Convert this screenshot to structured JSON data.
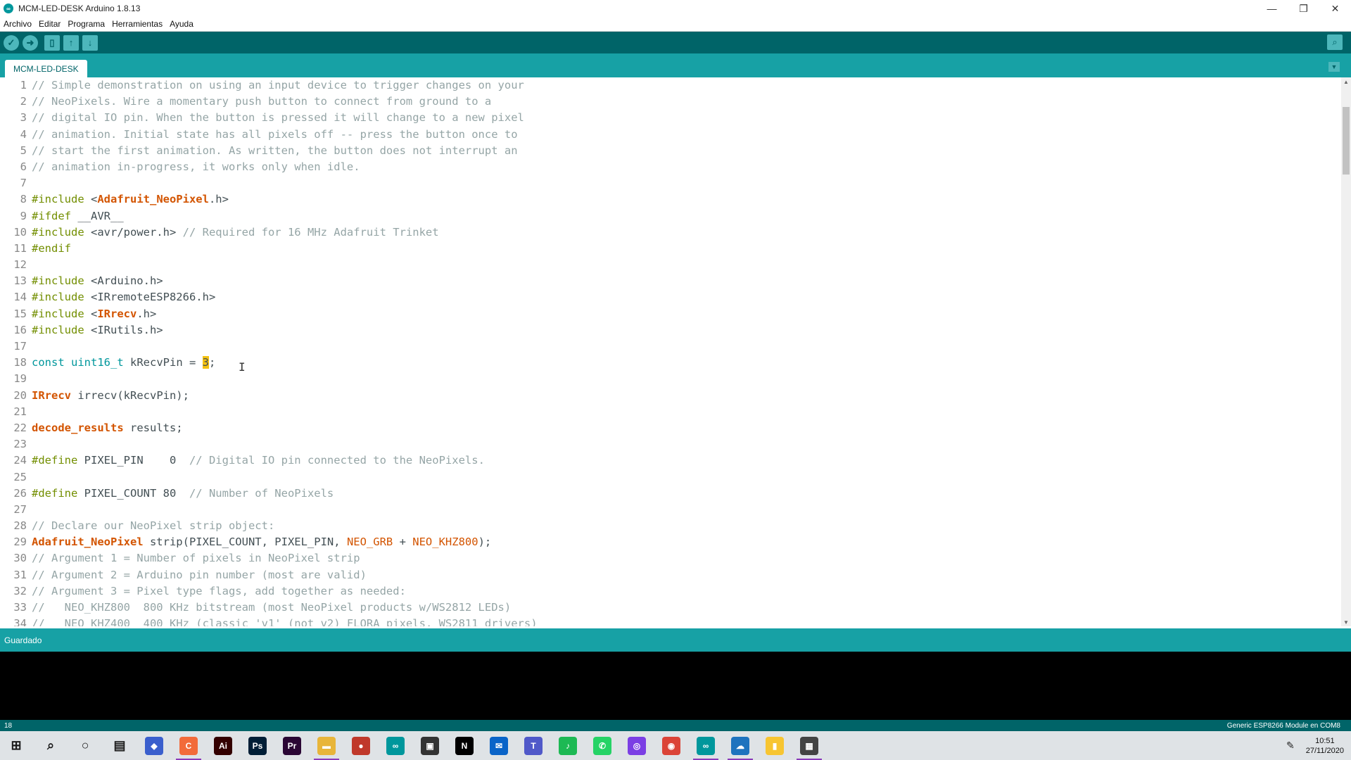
{
  "window": {
    "title": "MCM-LED-DESK Arduino 1.8.13",
    "controls": [
      "—",
      "❐",
      "✕"
    ]
  },
  "menubar": {
    "items": [
      "Archivo",
      "Editar",
      "Programa",
      "Herramientas",
      "Ayuda"
    ]
  },
  "toolbar": {
    "verify_icon": "check-icon",
    "upload_icon": "arrow-right-icon",
    "new_icon": "new-file-icon",
    "open_icon": "open-up-icon",
    "save_icon": "save-down-icon",
    "serial_icon": "magnifier-icon"
  },
  "tabs": {
    "active": "MCM-LED-DESK",
    "menu_icon": "chevron-down-icon"
  },
  "editor": {
    "cursor_line": 18,
    "lines": [
      {
        "n": "1",
        "parts": [
          {
            "c": "comment",
            "t": "// Simple demonstration on using an input device to trigger changes on your"
          }
        ]
      },
      {
        "n": "2",
        "parts": [
          {
            "c": "comment",
            "t": "// NeoPixels. Wire a momentary push button to connect from ground to a"
          }
        ]
      },
      {
        "n": "3",
        "parts": [
          {
            "c": "comment",
            "t": "// digital IO pin. When the button is pressed it will change to a new pixel"
          }
        ]
      },
      {
        "n": "4",
        "parts": [
          {
            "c": "comment",
            "t": "// animation. Initial state has all pixels off -- press the button once to"
          }
        ]
      },
      {
        "n": "5",
        "parts": [
          {
            "c": "comment",
            "t": "// start the first animation. As written, the button does not interrupt an"
          }
        ]
      },
      {
        "n": "6",
        "parts": [
          {
            "c": "comment",
            "t": "// animation in-progress, it works only when idle."
          }
        ]
      },
      {
        "n": "7",
        "parts": []
      },
      {
        "n": "8",
        "parts": [
          {
            "c": "directive",
            "t": "#include"
          },
          {
            "c": "plain",
            "t": " <"
          },
          {
            "c": "type",
            "t": "Adafruit_NeoPixel"
          },
          {
            "c": "plain",
            "t": ".h>"
          }
        ]
      },
      {
        "n": "9",
        "parts": [
          {
            "c": "directive",
            "t": "#ifdef"
          },
          {
            "c": "plain",
            "t": " __AVR__"
          }
        ]
      },
      {
        "n": "10",
        "parts": [
          {
            "c": "directive",
            "t": "#include"
          },
          {
            "c": "plain",
            "t": " <avr/power.h> "
          },
          {
            "c": "comment",
            "t": "// Required for 16 MHz Adafruit Trinket"
          }
        ]
      },
      {
        "n": "11",
        "parts": [
          {
            "c": "directive",
            "t": "#endif"
          }
        ]
      },
      {
        "n": "12",
        "parts": []
      },
      {
        "n": "13",
        "parts": [
          {
            "c": "directive",
            "t": "#include"
          },
          {
            "c": "plain",
            "t": " <Arduino.h>"
          }
        ]
      },
      {
        "n": "14",
        "parts": [
          {
            "c": "directive",
            "t": "#include"
          },
          {
            "c": "plain",
            "t": " <IRremoteESP8266.h>"
          }
        ]
      },
      {
        "n": "15",
        "parts": [
          {
            "c": "directive",
            "t": "#include"
          },
          {
            "c": "plain",
            "t": " <"
          },
          {
            "c": "type",
            "t": "IRrecv"
          },
          {
            "c": "plain",
            "t": ".h>"
          }
        ]
      },
      {
        "n": "16",
        "parts": [
          {
            "c": "directive",
            "t": "#include"
          },
          {
            "c": "plain",
            "t": " <IRutils.h>"
          }
        ]
      },
      {
        "n": "17",
        "parts": []
      },
      {
        "n": "18",
        "parts": [
          {
            "c": "keyword",
            "t": "const"
          },
          {
            "c": "plain",
            "t": " "
          },
          {
            "c": "keyword",
            "t": "uint16_t"
          },
          {
            "c": "plain",
            "t": " kRecvPin = "
          },
          {
            "c": "hl",
            "t": "3"
          },
          {
            "c": "plain",
            "t": ";"
          }
        ]
      },
      {
        "n": "19",
        "parts": []
      },
      {
        "n": "20",
        "parts": [
          {
            "c": "type",
            "t": "IRrecv"
          },
          {
            "c": "plain",
            "t": " irrecv(kRecvPin);"
          }
        ]
      },
      {
        "n": "21",
        "parts": []
      },
      {
        "n": "22",
        "parts": [
          {
            "c": "type",
            "t": "decode_results"
          },
          {
            "c": "plain",
            "t": " results;"
          }
        ]
      },
      {
        "n": "23",
        "parts": []
      },
      {
        "n": "24",
        "parts": [
          {
            "c": "directive",
            "t": "#define"
          },
          {
            "c": "plain",
            "t": " PIXEL_PIN    0  "
          },
          {
            "c": "comment",
            "t": "// Digital IO pin connected to the NeoPixels."
          }
        ]
      },
      {
        "n": "25",
        "parts": []
      },
      {
        "n": "26",
        "parts": [
          {
            "c": "directive",
            "t": "#define"
          },
          {
            "c": "plain",
            "t": " PIXEL_COUNT 80  "
          },
          {
            "c": "comment",
            "t": "// Number of NeoPixels"
          }
        ]
      },
      {
        "n": "27",
        "parts": []
      },
      {
        "n": "28",
        "parts": [
          {
            "c": "comment",
            "t": "// Declare our NeoPixel strip object:"
          }
        ]
      },
      {
        "n": "29",
        "parts": [
          {
            "c": "type",
            "t": "Adafruit_NeoPixel"
          },
          {
            "c": "plain",
            "t": " strip(PIXEL_COUNT, PIXEL_PIN, "
          },
          {
            "c": "const",
            "t": "NEO_GRB"
          },
          {
            "c": "plain",
            "t": " + "
          },
          {
            "c": "const",
            "t": "NEO_KHZ800"
          },
          {
            "c": "plain",
            "t": ");"
          }
        ]
      },
      {
        "n": "30",
        "parts": [
          {
            "c": "comment",
            "t": "// Argument 1 = Number of pixels in NeoPixel strip"
          }
        ]
      },
      {
        "n": "31",
        "parts": [
          {
            "c": "comment",
            "t": "// Argument 2 = Arduino pin number (most are valid)"
          }
        ]
      },
      {
        "n": "32",
        "parts": [
          {
            "c": "comment",
            "t": "// Argument 3 = Pixel type flags, add together as needed:"
          }
        ]
      },
      {
        "n": "33",
        "parts": [
          {
            "c": "comment",
            "t": "//   NEO_KHZ800  800 KHz bitstream (most NeoPixel products w/WS2812 LEDs)"
          }
        ]
      },
      {
        "n": "34",
        "parts": [
          {
            "c": "comment",
            "t": "//   NEO_KHZ400  400 KHz (classic 'v1' (not v2) FLORA pixels, WS2811 drivers)"
          }
        ]
      }
    ]
  },
  "status": {
    "message": "Guardado"
  },
  "bottombar": {
    "line_number": "18",
    "board": "Generic ESP8266 Module en COM8"
  },
  "taskbar": {
    "icons": [
      {
        "name": "windows-start-icon",
        "color": "#1a1a1a",
        "glyph": "⊞",
        "active": false
      },
      {
        "name": "search-icon",
        "color": "#1a1a1a",
        "glyph": "⌕",
        "active": false
      },
      {
        "name": "cortana-icon",
        "color": "#1a1a1a",
        "glyph": "○",
        "active": false
      },
      {
        "name": "task-view-icon",
        "color": "#1a1a1a",
        "glyph": "▤",
        "active": false
      },
      {
        "name": "app-globe-icon",
        "color": "#3a5fcd",
        "glyph": "◆",
        "active": false
      },
      {
        "name": "canva-app-icon",
        "color": "#f26b3a",
        "glyph": "C",
        "active": true
      },
      {
        "name": "illustrator-icon",
        "color": "#330000",
        "glyph": "Ai",
        "active": false
      },
      {
        "name": "photoshop-icon",
        "color": "#001e36",
        "glyph": "Ps",
        "active": false
      },
      {
        "name": "premiere-icon",
        "color": "#2a0634",
        "glyph": "Pr",
        "active": false
      },
      {
        "name": "file-explorer-icon",
        "color": "#e8b53a",
        "glyph": "▬",
        "active": true
      },
      {
        "name": "app-red-icon",
        "color": "#c0392b",
        "glyph": "●",
        "active": false
      },
      {
        "name": "arduino-icon-2",
        "color": "#00979c",
        "glyph": "∞",
        "active": false
      },
      {
        "name": "store-icon",
        "color": "#333",
        "glyph": "▣",
        "active": false
      },
      {
        "name": "netflix-icon",
        "color": "#000",
        "glyph": "N",
        "active": false
      },
      {
        "name": "mail-icon",
        "color": "#0a64c8",
        "glyph": "✉",
        "active": false
      },
      {
        "name": "teams-icon",
        "color": "#5059c9",
        "glyph": "T",
        "active": false
      },
      {
        "name": "spotify-icon",
        "color": "#1db954",
        "glyph": "♪",
        "active": false
      },
      {
        "name": "whatsapp-icon",
        "color": "#25d366",
        "glyph": "✆",
        "active": false
      },
      {
        "name": "app-purple-icon",
        "color": "#7b3fe4",
        "glyph": "◎",
        "active": false
      },
      {
        "name": "chrome-icon",
        "color": "#db4437",
        "glyph": "◉",
        "active": false
      },
      {
        "name": "arduino-icon",
        "color": "#00979c",
        "glyph": "∞",
        "active": true
      },
      {
        "name": "remote-desktop-icon",
        "color": "#1e73be",
        "glyph": "☁",
        "active": true
      },
      {
        "name": "sticky-notes-icon",
        "color": "#f7c531",
        "glyph": "▮",
        "active": false
      },
      {
        "name": "calculator-icon",
        "color": "#444",
        "glyph": "▦",
        "active": true
      }
    ],
    "tray_icon": "pen-icon",
    "time": "10:51",
    "date": "27/11/2020"
  }
}
